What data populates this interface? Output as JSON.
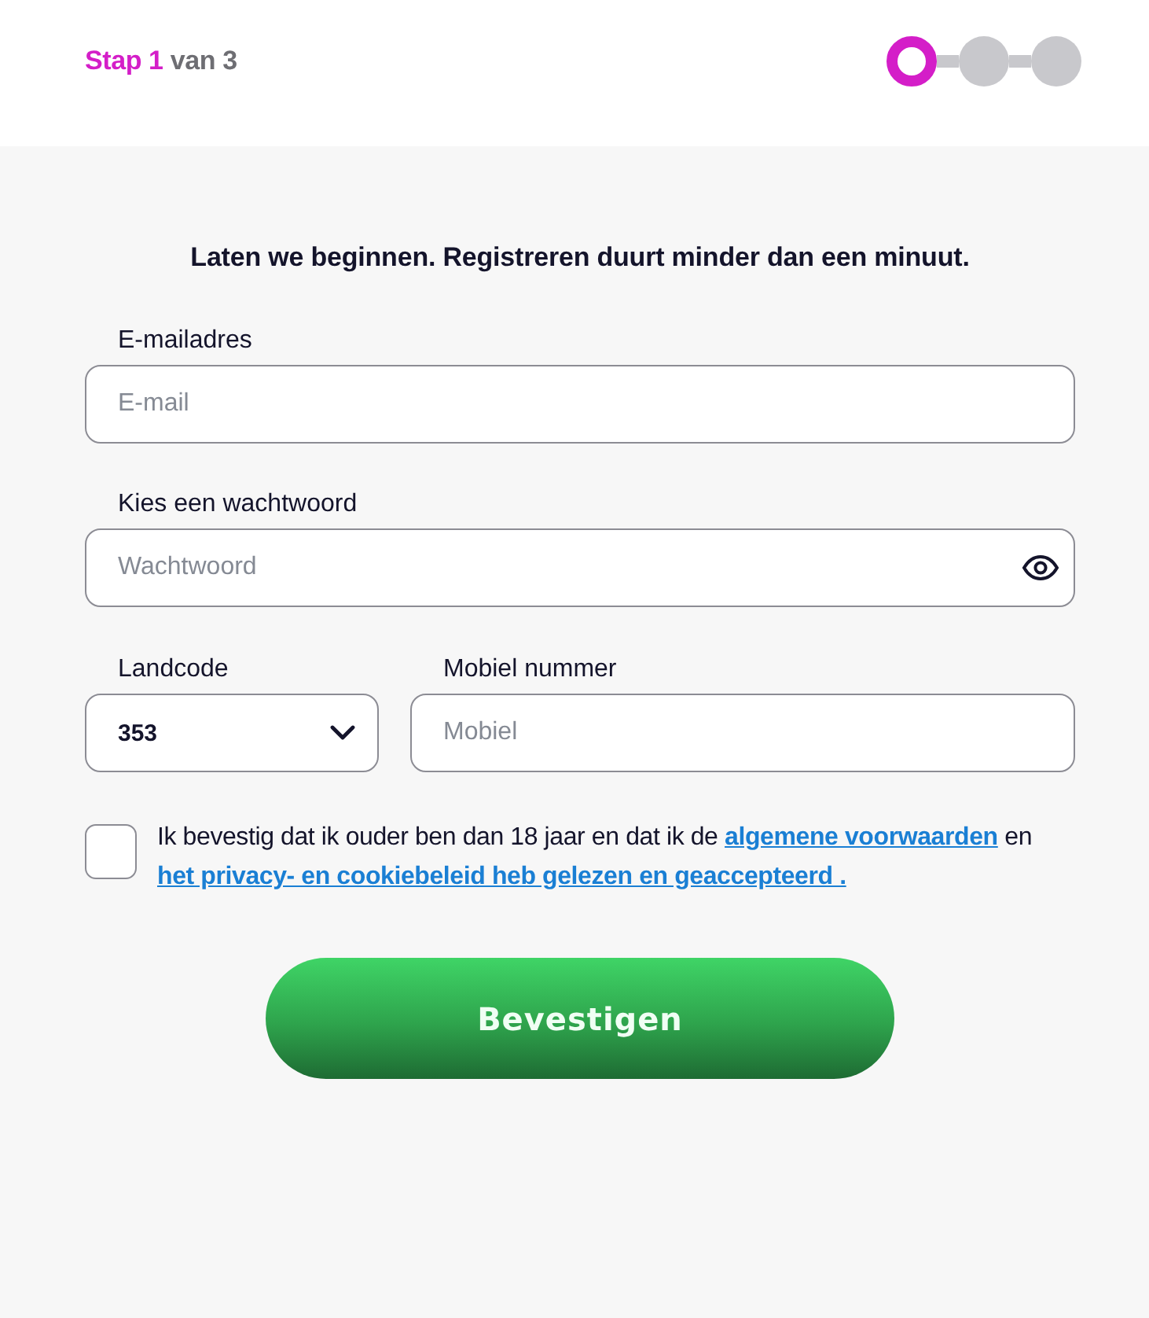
{
  "header": {
    "step_label": "Stap 1",
    "step_of": "van 3",
    "steps": [
      {
        "selected": true
      },
      {
        "selected": false
      },
      {
        "selected": false
      }
    ]
  },
  "form": {
    "intro": "Laten we beginnen. Registreren duurt minder dan een minuut.",
    "fields": [
      {
        "kind": "text",
        "label": "E-mailadres",
        "placeholder": "E-mail"
      },
      {
        "kind": "password",
        "label": "Kies een wachtwoord",
        "placeholder": "Wachtwoord"
      }
    ],
    "phone": {
      "country_label": "Landcode",
      "country_value": "353",
      "number_label": "Mobiel nummer",
      "number_placeholder": "Mobiel"
    },
    "consent": {
      "checked": false,
      "parts": [
        {
          "kind": "text",
          "text": "Ik bevestig dat ik ouder ben dan 18 jaar en dat ik de"
        },
        {
          "kind": "link",
          "text": "algemene voorwaarden"
        },
        {
          "kind": "text",
          "text": "en"
        },
        {
          "kind": "link",
          "text": "het privacy- en cookiebeleid heb gelezen en geaccepteerd ."
        }
      ]
    },
    "submit": "Bevestigen"
  }
}
